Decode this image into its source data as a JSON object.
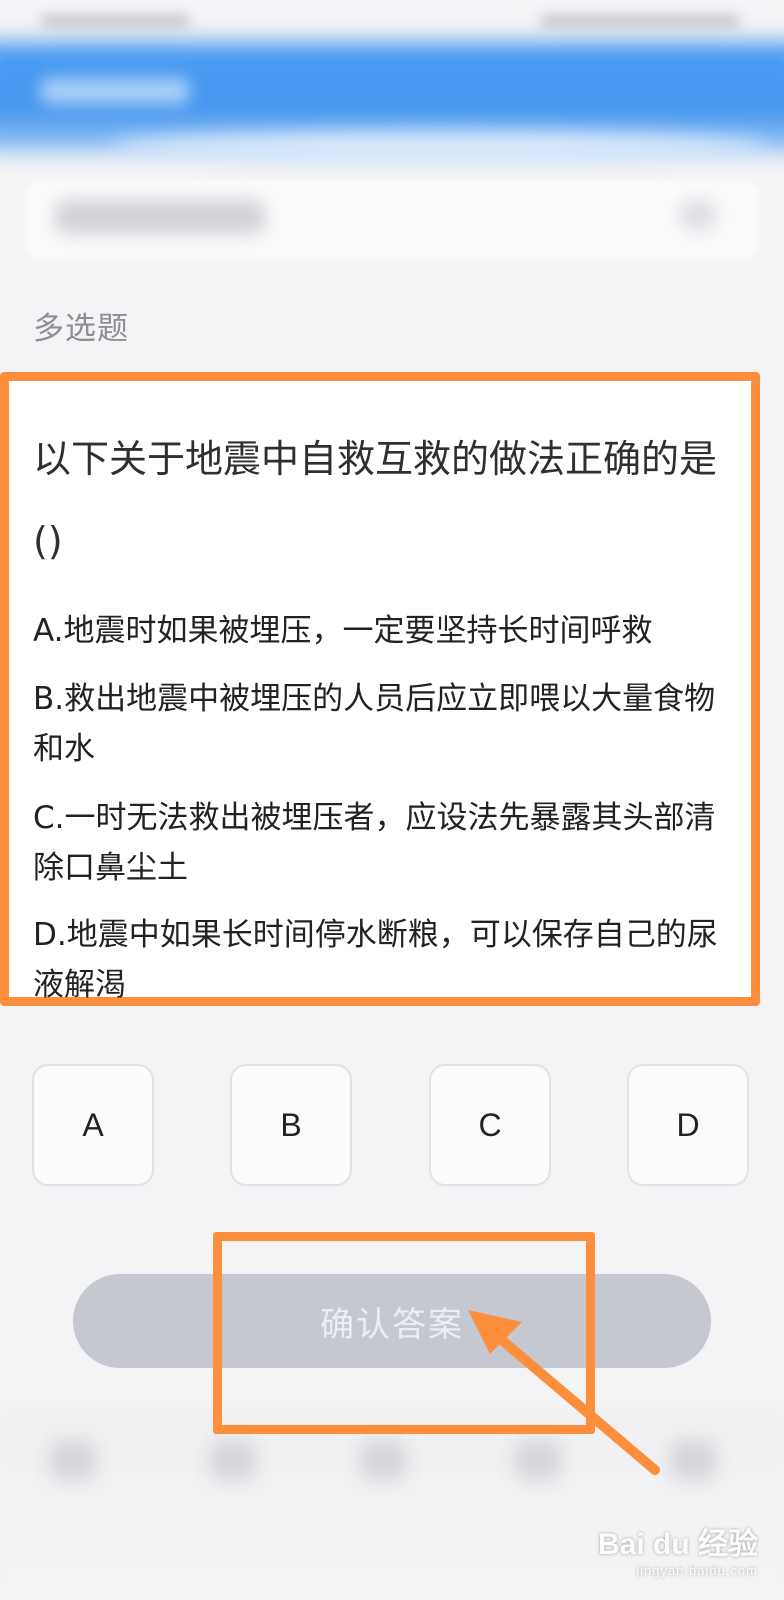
{
  "question_type": "多选题",
  "question": {
    "text": "以下关于地震中自救互救的做法正确的是()",
    "options": [
      {
        "letter": "A",
        "text": "A.地震时如果被埋压，一定要坚持长时间呼救"
      },
      {
        "letter": "B",
        "text": "B.救出地震中被埋压的人员后应立即喂以大量食物和水"
      },
      {
        "letter": "C",
        "text": "C.一时无法救出被埋压者，应设法先暴露其头部清除口鼻尘土"
      },
      {
        "letter": "D",
        "text": "D.地震中如果长时间停水断粮，可以保存自己的尿液解渴"
      }
    ]
  },
  "answer_buttons": [
    "A",
    "B",
    "C",
    "D"
  ],
  "confirm_button": {
    "label": "确认答案",
    "enabled": false
  },
  "colors": {
    "highlight": "#fd8f3c",
    "header_blue": "#4596ef",
    "confirm_disabled": "#c5c8d1"
  },
  "watermark": {
    "main": "Bai du 经验",
    "sub": "jingyan.baidu.com"
  }
}
